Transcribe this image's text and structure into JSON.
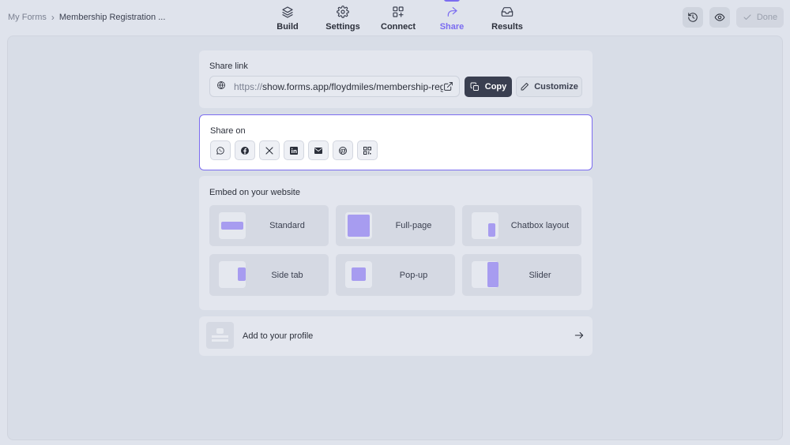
{
  "breadcrumb": {
    "root": "My Forms",
    "separator": "›",
    "current": "Membership Registration ..."
  },
  "nav": {
    "items": [
      {
        "label": "Build",
        "icon": "layers-icon"
      },
      {
        "label": "Settings",
        "icon": "gear-icon"
      },
      {
        "label": "Connect",
        "icon": "connect-grid-icon"
      },
      {
        "label": "Share",
        "icon": "share-arrow-icon",
        "active": true
      },
      {
        "label": "Results",
        "icon": "inbox-icon"
      }
    ],
    "accent": "#7b6cf0"
  },
  "actions": {
    "history_icon": "history-icon",
    "preview_icon": "eye-icon",
    "done_label": "Done"
  },
  "share_link": {
    "title": "Share link",
    "url_prefix": "https://",
    "url_rest": "show.forms.app/floydmiles/membership-reg",
    "copy_label": "Copy",
    "customize_label": "Customize"
  },
  "share_on": {
    "title": "Share on",
    "platforms": [
      "whatsapp-icon",
      "facebook-icon",
      "x-icon",
      "linkedin-icon",
      "email-icon",
      "wordpress-icon",
      "qr-code-icon"
    ]
  },
  "embed": {
    "title": "Embed on your website",
    "options": [
      "Standard",
      "Full-page",
      "Chatbox layout",
      "Side tab",
      "Pop-up",
      "Slider"
    ]
  },
  "profile": {
    "label": "Add to your profile"
  }
}
